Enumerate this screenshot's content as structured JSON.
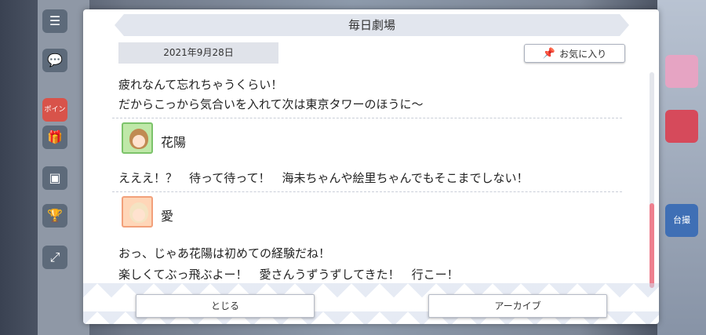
{
  "dialog": {
    "title": "毎日劇場",
    "date": "2021年9月28日",
    "favorite_label": "お気に入り",
    "favorite_icon": "pin-icon"
  },
  "log": {
    "lines_top": [
      "疲れなんて忘れちゃうくらい！",
      "だからこっから気合いを入れて次は東京タワーのほうに〜"
    ],
    "entries": [
      {
        "speaker": "花陽",
        "avatar_color": "#bfe8a8",
        "lines": [
          "えええ！？　待って待って！　海未ちゃんや絵里ちゃんでもそこまでしない！"
        ]
      },
      {
        "speaker": "愛",
        "avatar_color": "#ffd6b8",
        "lines": [
          "おっ、じゃあ花陽は初めての経験だね！",
          "楽しくてぶっ飛ぶよー！　愛さんうずうずしてきた！　行こー！"
        ]
      }
    ]
  },
  "scroll": {
    "position": 0.61
  },
  "footer": {
    "close_label": "とじる",
    "archive_label": "アーカイブ"
  },
  "background": {
    "left_badge": "ポイント",
    "right_label": "台撮"
  },
  "colors": {
    "scroll_thumb": "#ee7f8e",
    "title_bar": "#e2e6ee"
  }
}
